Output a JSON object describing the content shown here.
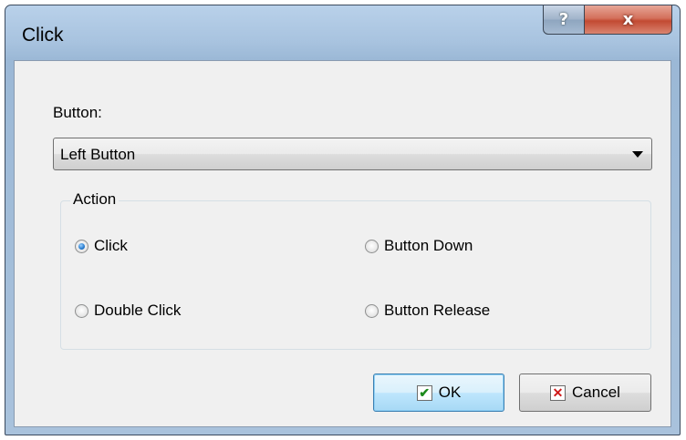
{
  "window": {
    "title": "Click",
    "help_label": "?",
    "close_label": "x"
  },
  "button_field": {
    "label": "Button:",
    "selected": "Left Button"
  },
  "action_group": {
    "legend": "Action",
    "options": [
      {
        "label": "Click",
        "checked": true
      },
      {
        "label": "Double Click",
        "checked": false
      },
      {
        "label": "Button Down",
        "checked": false
      },
      {
        "label": "Button Release",
        "checked": false
      }
    ]
  },
  "buttons": {
    "ok_label": "OK",
    "ok_icon": "✔",
    "cancel_label": "Cancel",
    "cancel_icon": "✕"
  },
  "colors": {
    "accent": "#3c7fb1",
    "close": "#c24a32"
  }
}
